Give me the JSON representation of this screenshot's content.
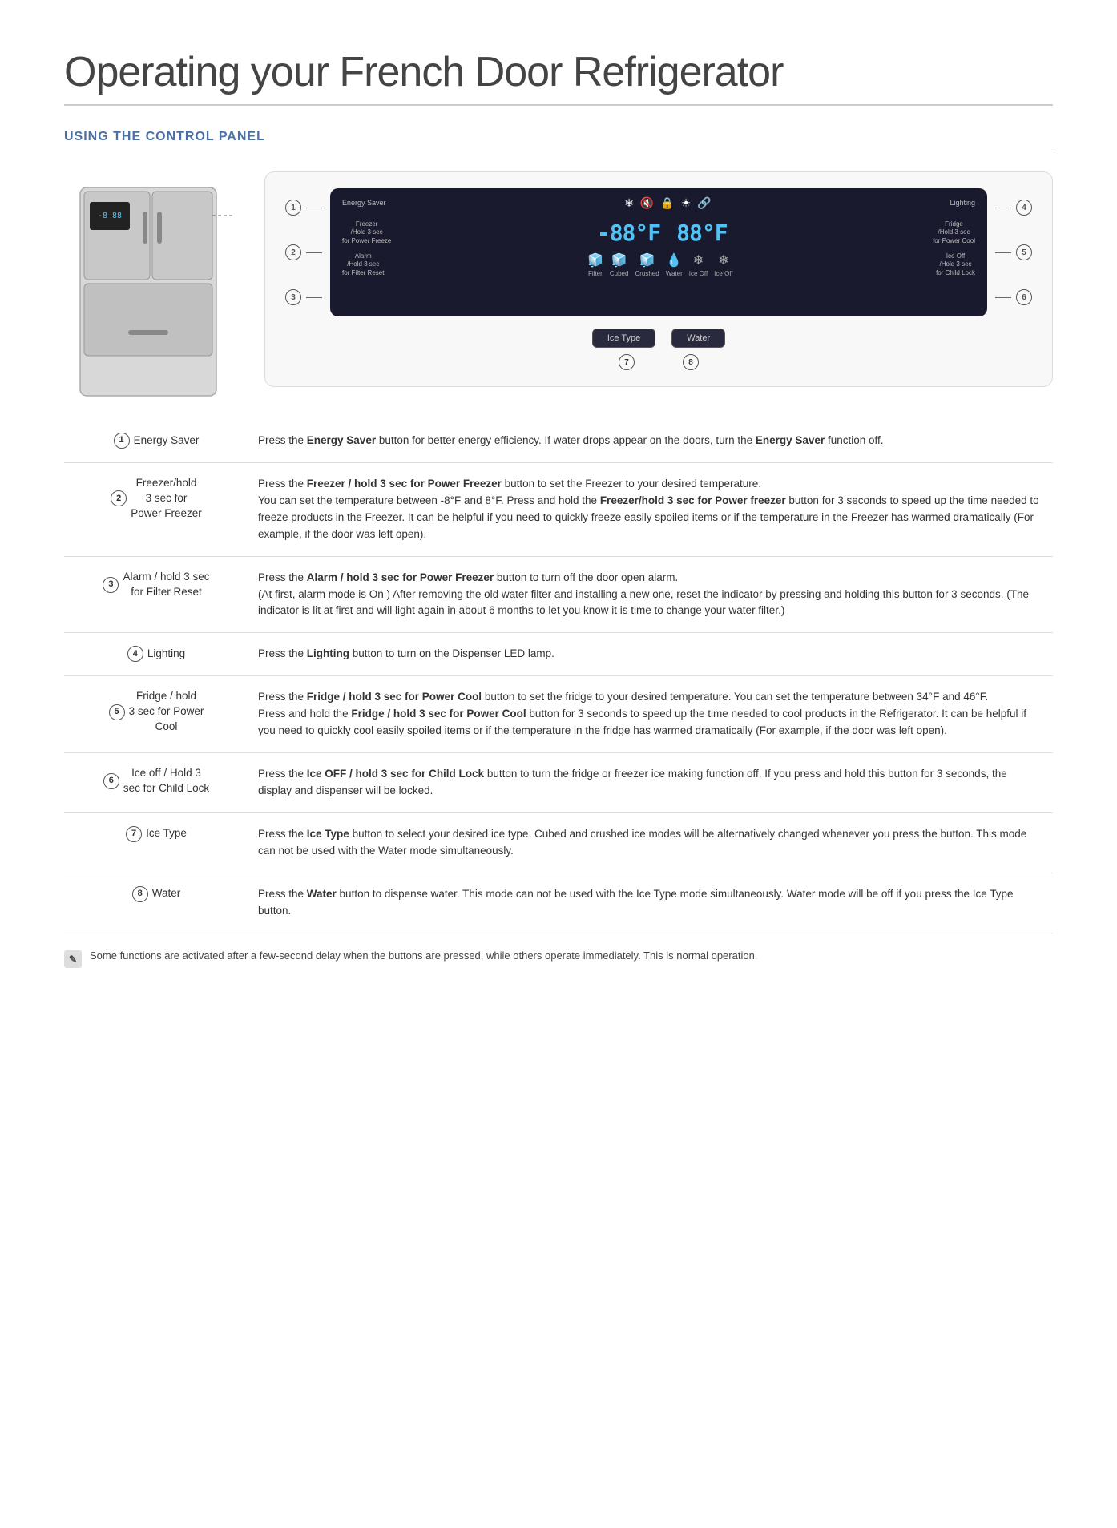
{
  "page": {
    "title": "Operating your French Door Refrigerator",
    "section": "USING THE CONTROL PANEL"
  },
  "panel": {
    "btn1_label": "Energy\nSaver",
    "btn2_label": "Freezer\n/Hold 3 sec\nfor Power Freeze",
    "btn3_label": "Alarm\n/Hold 3 sec\nfor Filter Reset",
    "btn4_label": "Lighting",
    "btn5_label": "Fridge\n/Hold 3 sec\nfor Power Cool",
    "btn6_label": "Ice Off\n/Hold 3 sec\nfor Child Lock",
    "temp_left": "-88°F",
    "temp_right": "88°F",
    "icons": [
      "❄️",
      "🔇",
      "🔒",
      "☀️",
      "🔒"
    ],
    "dispenser_labels": [
      "Filter",
      "Cubed",
      "Crushed",
      "Water",
      "Ice Off",
      "Ice Off"
    ],
    "bottom_btn1": "Ice Type",
    "bottom_btn2": "Water",
    "num7": "7",
    "num8": "8"
  },
  "numbers": {
    "n1": "1",
    "n2": "2",
    "n3": "3",
    "n4": "4",
    "n5": "5",
    "n6": "6",
    "n7": "7",
    "n8": "8"
  },
  "rows": [
    {
      "num": "1",
      "label": "Energy Saver",
      "label2": "",
      "label3": "",
      "desc": "Press the <b>Energy Saver</b> button for better energy efficiency. If water drops appear on the doors, turn the <b>Energy Saver</b> function off."
    },
    {
      "num": "2",
      "label": "Freezer/hold",
      "label2": "3 sec for",
      "label3": "Power Freezer",
      "desc": "Press the <b>Freezer / hold 3 sec for Power Freezer</b> button to set the Freezer to your desired temperature.<br>You can set the temperature between -8°F and 8°F. Press and hold the <b>Freezer/hold 3 sec for Power freezer</b> button for 3 seconds to speed up the time needed to freeze products in the Freezer. It can be helpful if you need to quickly freeze easily spoiled items or if the temperature in the Freezer has warmed dramatically (For example, if the door was left open)."
    },
    {
      "num": "3",
      "label": "Alarm / hold 3 sec",
      "label2": "for Filter Reset",
      "label3": "",
      "desc": "Press the <b>Alarm / hold 3 sec for Power Freezer</b> button to turn off the door open alarm.<br>(At first, alarm mode is On ) After removing the old water filter and installing a new one, reset the indicator by pressing and holding this button for 3 seconds. (The indicator is lit at first and will light again in about 6 months to let you know it is time to change your water filter.)"
    },
    {
      "num": "4",
      "label": "Lighting",
      "label2": "",
      "label3": "",
      "desc": "Press the <b>Lighting</b> button to turn on the Dispenser LED lamp."
    },
    {
      "num": "5",
      "label": "Fridge / hold",
      "label2": "3 sec for Power",
      "label3": "Cool",
      "desc": "Press the <b>Fridge / hold 3 sec for Power Cool</b> button to set the fridge to your desired temperature. You can set the temperature between 34°F and 46°F.<br>Press and hold the <b>Fridge / hold 3 sec for Power Cool</b> button for 3 seconds to speed up the time needed to cool products in the Refrigerator. It can be helpful if you need to quickly cool easily spoiled items or if the temperature in the fridge has warmed dramatically (For example, if the door was left open)."
    },
    {
      "num": "6",
      "label": "Ice off / Hold  3",
      "label2": "sec for Child Lock",
      "label3": "",
      "desc": "Press the <b>Ice OFF / hold 3 sec for Child Lock</b> button to turn the fridge or freezer ice making function off. If you press and hold this button for 3 seconds, the display and dispenser will be locked."
    },
    {
      "num": "7",
      "label": "Ice Type",
      "label2": "",
      "label3": "",
      "desc": "Press the <b>Ice Type</b> button to select your desired ice type. Cubed and crushed ice modes will be alternatively changed whenever you press the button. This mode can not be used with the Water mode simultaneously."
    },
    {
      "num": "8",
      "label": "Water",
      "label2": "",
      "label3": "",
      "desc": "Press the <b>Water</b> button to dispense water. This mode can not be used with the Ice Type mode simultaneously. Water mode will be off if you press the Ice Type button."
    }
  ],
  "note": "Some functions are activated after a few-second delay when the buttons are pressed, while others operate immediately. This is normal operation."
}
